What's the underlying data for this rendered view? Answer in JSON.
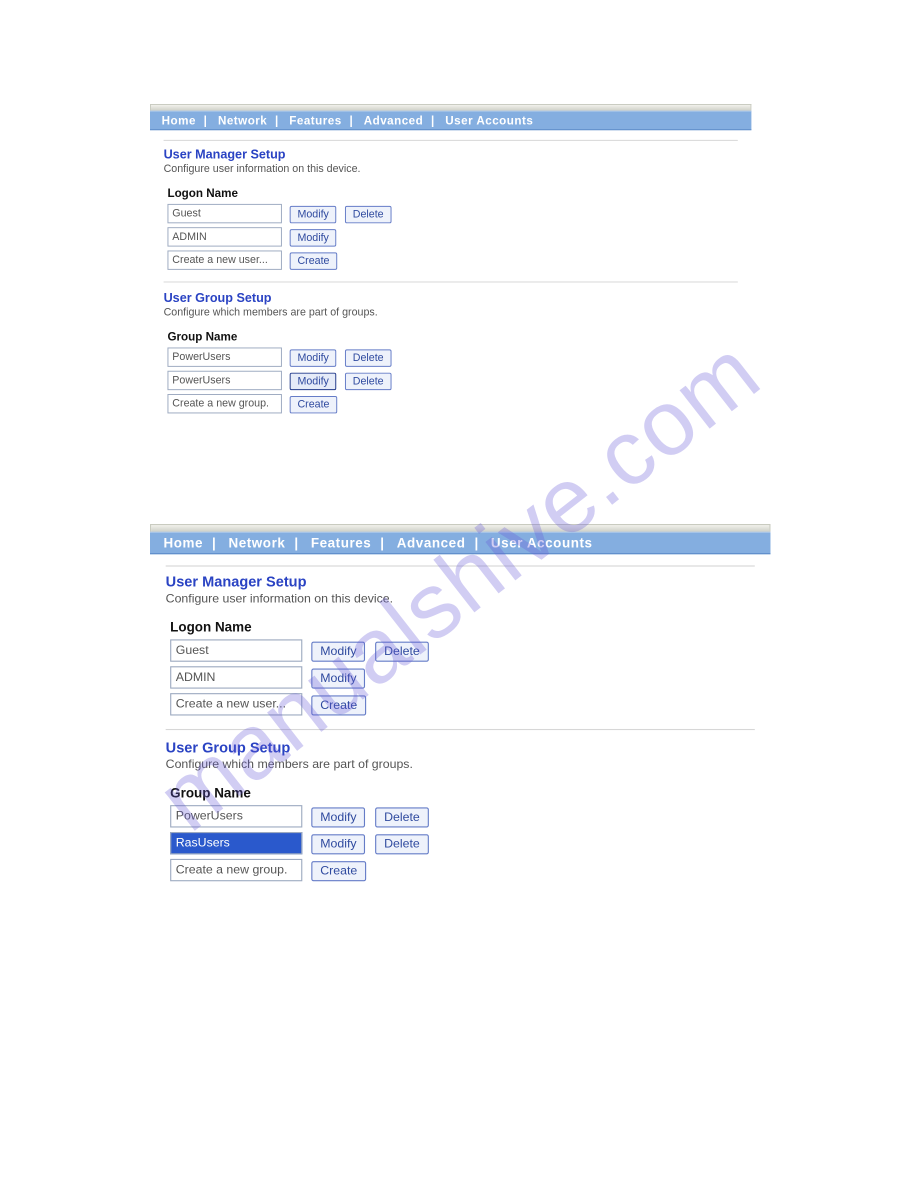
{
  "watermark": "manualshive.com",
  "nav": {
    "items": [
      "Home",
      "Network",
      "Features",
      "Advanced",
      "User Accounts"
    ]
  },
  "userManager": {
    "title": "User Manager Setup",
    "subtitle": "Configure user information on this device.",
    "columnHeader": "Logon Name"
  },
  "userGroup": {
    "title": "User Group Setup",
    "subtitle": "Configure which members are part of groups.",
    "columnHeader": "Group Name"
  },
  "buttons": {
    "modify": "Modify",
    "delete": "Delete",
    "create": "Create"
  },
  "panelA": {
    "users": [
      {
        "name": "Guest",
        "modify": true,
        "delete": true
      },
      {
        "name": "ADMIN",
        "modify": true,
        "delete": false
      },
      {
        "name": "Create a new user...",
        "create": true
      }
    ],
    "groups": [
      {
        "name": "PowerUsers",
        "modify": true,
        "delete": true
      },
      {
        "name": "PowerUsers",
        "modify": true,
        "delete": true,
        "modifyFocus": true
      },
      {
        "name": "Create a new group.",
        "create": true
      }
    ]
  },
  "panelB": {
    "users": [
      {
        "name": "Guest",
        "modify": true,
        "delete": true
      },
      {
        "name": "ADMIN",
        "modify": true,
        "delete": false
      },
      {
        "name": "Create a new user...",
        "create": true
      }
    ],
    "groups": [
      {
        "name": "PowerUsers",
        "modify": true,
        "delete": true
      },
      {
        "name": "RasUsers",
        "modify": true,
        "delete": true,
        "selected": true
      },
      {
        "name": "Create a new group.",
        "create": true
      }
    ]
  }
}
